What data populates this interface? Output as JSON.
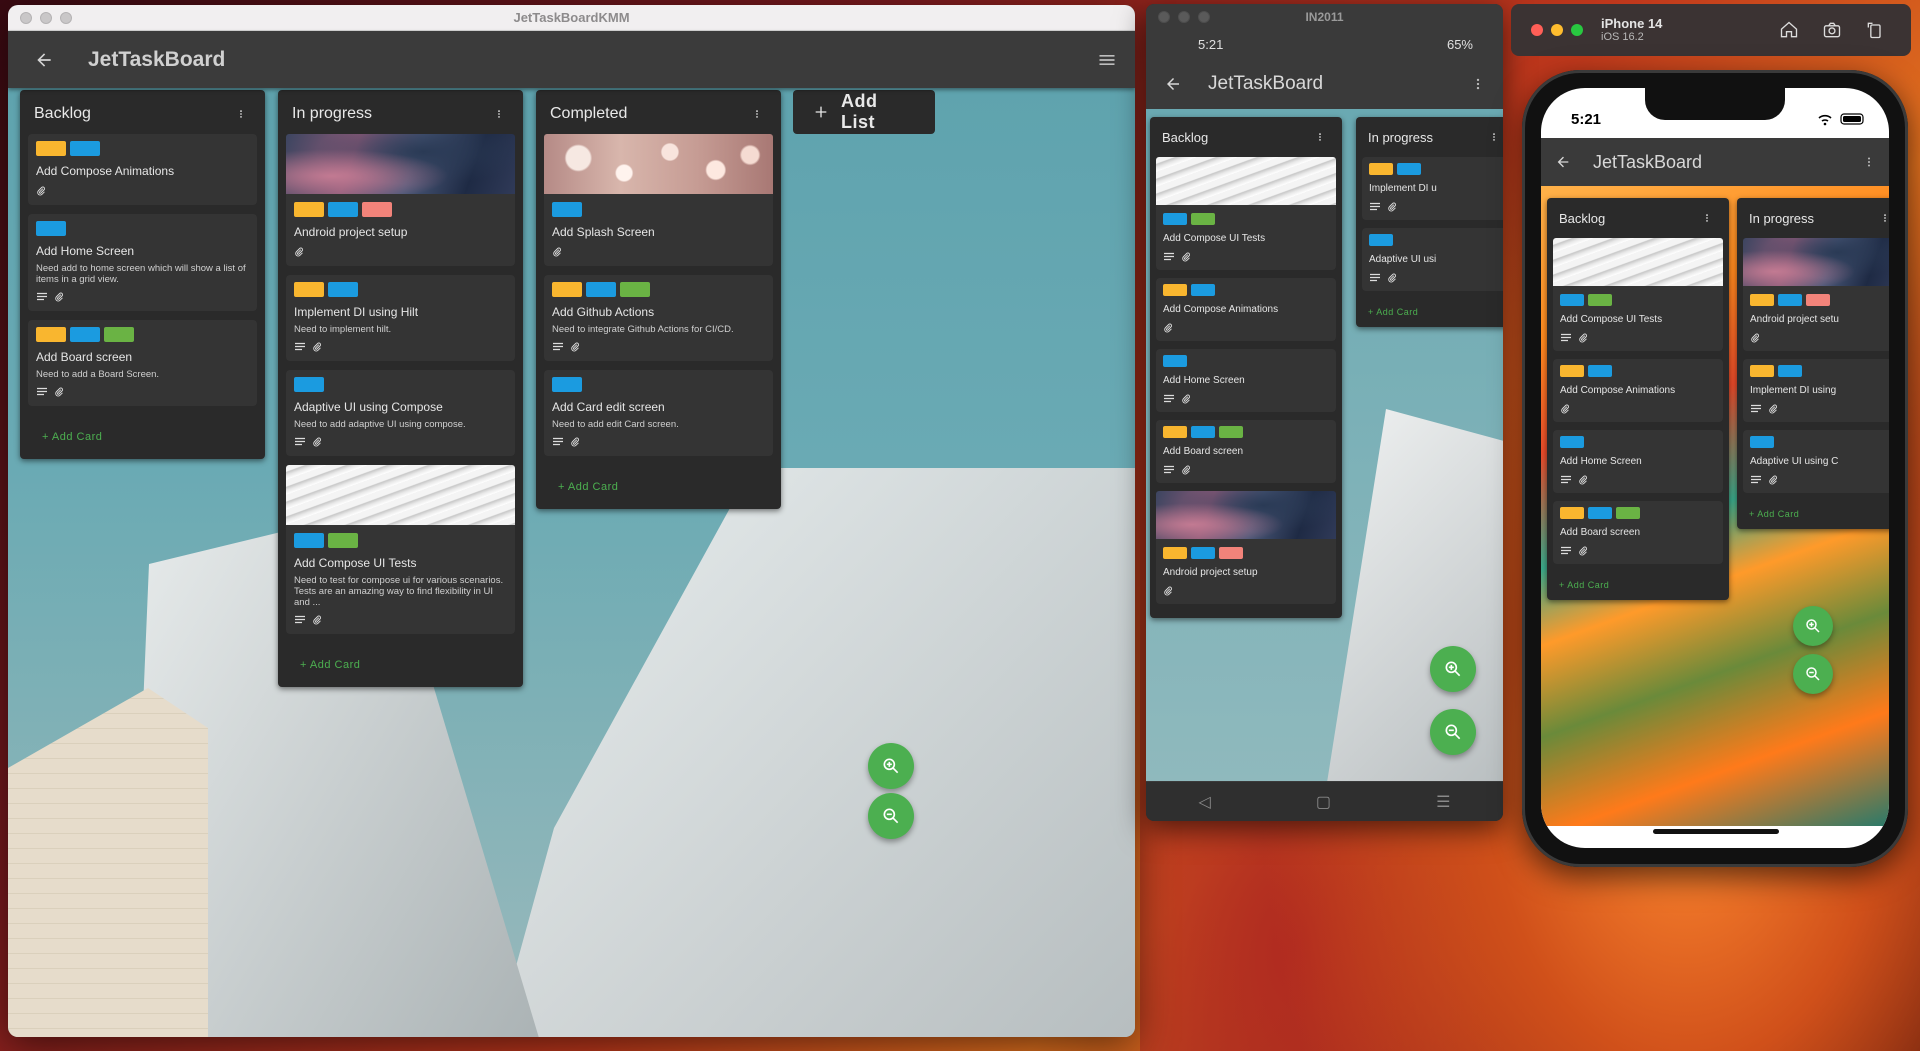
{
  "desktop": {
    "window_title": "JetTaskBoardKMM",
    "app_title": "JetTaskBoard",
    "add_list_label": "Add List",
    "lists": [
      {
        "title": "Backlog",
        "add_card_label": "+ Add Card",
        "cards": [
          {
            "title": "Add Compose Animations",
            "description": "",
            "labels": [
              "#f9b62f",
              "#1b9be0"
            ],
            "image": "",
            "icons": [
              "attachment-icon"
            ]
          },
          {
            "title": "Add Home Screen",
            "description": "Need add to home screen which will show a list of items in a grid view.",
            "labels": [
              "#1b9be0"
            ],
            "image": "",
            "icons": [
              "description-icon",
              "attachment-icon"
            ]
          },
          {
            "title": "Add Board screen",
            "description": "Need to add a Board Screen.",
            "labels": [
              "#f9b62f",
              "#1b9be0",
              "#6ab344"
            ],
            "image": "",
            "icons": [
              "description-icon",
              "attachment-icon"
            ]
          }
        ]
      },
      {
        "title": "In progress",
        "add_card_label": "+ Add Card",
        "cards": [
          {
            "title": "Android project setup",
            "description": "",
            "labels": [
              "#f9b62f",
              "#1b9be0",
              "#f2837a"
            ],
            "image": "smoke",
            "icons": [
              "attachment-icon"
            ]
          },
          {
            "title": "Implement DI using Hilt",
            "description": "Need to implement hilt.",
            "labels": [
              "#f9b62f",
              "#1b9be0"
            ],
            "image": "",
            "icons": [
              "description-icon",
              "attachment-icon"
            ]
          },
          {
            "title": "Adaptive UI using Compose",
            "description": "Need to add adaptive UI using compose.",
            "labels": [
              "#1b9be0"
            ],
            "image": "",
            "icons": [
              "description-icon",
              "attachment-icon"
            ]
          },
          {
            "title": "Add Compose UI Tests",
            "description": "Need to test for compose ui for various scenarios. Tests are an amazing way to find flexibility in UI and ...",
            "labels": [
              "#1b9be0",
              "#6ab344"
            ],
            "image": "paper",
            "icons": [
              "description-icon",
              "attachment-icon"
            ]
          }
        ]
      },
      {
        "title": "Completed",
        "add_card_label": "+ Add Card",
        "cards": [
          {
            "title": "Add Splash Screen",
            "description": "",
            "labels": [
              "#1b9be0"
            ],
            "image": "bokeh",
            "icons": [
              "attachment-icon"
            ]
          },
          {
            "title": "Add Github Actions",
            "description": "Need to integrate Github Actions for CI/CD.",
            "labels": [
              "#f9b62f",
              "#1b9be0",
              "#6ab344"
            ],
            "image": "",
            "icons": [
              "description-icon",
              "attachment-icon"
            ]
          },
          {
            "title": "Add Card edit screen",
            "description": "Need to add edit Card screen.",
            "labels": [
              "#1b9be0"
            ],
            "image": "",
            "icons": [
              "description-icon",
              "attachment-icon"
            ]
          }
        ]
      }
    ]
  },
  "android": {
    "window_title": "IN2011",
    "status_time": "5:21",
    "battery": "65%",
    "app_title": "JetTaskBoard",
    "lists": [
      {
        "title": "Backlog",
        "add_card_label": "",
        "cards": [
          {
            "title": "Add Compose UI Tests",
            "labels": [
              "#1b9be0",
              "#6ab344"
            ],
            "image": "paper",
            "icons": [
              "description-icon",
              "attachment-icon"
            ]
          },
          {
            "title": "Add Compose Animations",
            "labels": [
              "#f9b62f",
              "#1b9be0"
            ],
            "image": "",
            "icons": [
              "attachment-icon"
            ]
          },
          {
            "title": "Add Home Screen",
            "labels": [
              "#1b9be0"
            ],
            "image": "",
            "icons": [
              "description-icon",
              "attachment-icon"
            ]
          },
          {
            "title": "Add Board screen",
            "labels": [
              "#f9b62f",
              "#1b9be0",
              "#6ab344"
            ],
            "image": "",
            "icons": [
              "description-icon",
              "attachment-icon"
            ]
          },
          {
            "title": "Android project setup",
            "labels": [
              "#f9b62f",
              "#1b9be0",
              "#f2837a"
            ],
            "image": "smoke",
            "icons": [
              "attachment-icon"
            ]
          }
        ]
      },
      {
        "title": "In progress",
        "add_card_label": "+ Add Card",
        "cards": [
          {
            "title": "Implement DI u",
            "labels": [
              "#f9b62f",
              "#1b9be0"
            ],
            "image": "",
            "icons": [
              "description-icon",
              "attachment-icon"
            ]
          },
          {
            "title": "Adaptive UI usi",
            "labels": [
              "#1b9be0"
            ],
            "image": "",
            "icons": [
              "description-icon",
              "attachment-icon"
            ]
          }
        ]
      }
    ]
  },
  "ios": {
    "device_name": "iPhone 14",
    "os_version": "iOS 16.2",
    "status_time": "5:21",
    "app_title": "JetTaskBoard",
    "lists": [
      {
        "title": "Backlog",
        "add_card_label": "+ Add Card",
        "cards": [
          {
            "title": "Add Compose UI Tests",
            "labels": [
              "#1b9be0",
              "#6ab344"
            ],
            "image": "paper",
            "icons": [
              "description-icon",
              "attachment-icon"
            ]
          },
          {
            "title": "Add Compose Animations",
            "labels": [
              "#f9b62f",
              "#1b9be0"
            ],
            "image": "",
            "icons": [
              "attachment-icon"
            ]
          },
          {
            "title": "Add Home Screen",
            "labels": [
              "#1b9be0"
            ],
            "image": "",
            "icons": [
              "description-icon",
              "attachment-icon"
            ]
          },
          {
            "title": "Add Board screen",
            "labels": [
              "#f9b62f",
              "#1b9be0",
              "#6ab344"
            ],
            "image": "",
            "icons": [
              "description-icon",
              "attachment-icon"
            ]
          }
        ]
      },
      {
        "title": "In progress",
        "add_card_label": "+ Add Card",
        "cards": [
          {
            "title": "Android project setu",
            "labels": [
              "#f9b62f",
              "#1b9be0",
              "#f2837a"
            ],
            "image": "smoke",
            "icons": [
              "attachment-icon"
            ]
          },
          {
            "title": "Implement DI using",
            "labels": [
              "#f9b62f",
              "#1b9be0"
            ],
            "image": "",
            "icons": [
              "description-icon",
              "attachment-icon"
            ]
          },
          {
            "title": "Adaptive UI using C",
            "labels": [
              "#1b9be0"
            ],
            "image": "",
            "icons": [
              "description-icon",
              "attachment-icon"
            ]
          }
        ]
      }
    ]
  },
  "colors": {
    "accent_green": "#4caf50",
    "label_yellow": "#f9b62f",
    "label_blue": "#1b9be0",
    "label_green": "#6ab344",
    "label_red": "#f2837a"
  },
  "icons": {
    "back": "arrow-left-icon",
    "menu": "hamburger-menu-icon",
    "more": "more-vert-icon",
    "zoom_in": "zoom-in-icon",
    "zoom_out": "zoom-out-icon",
    "add": "plus-icon"
  }
}
